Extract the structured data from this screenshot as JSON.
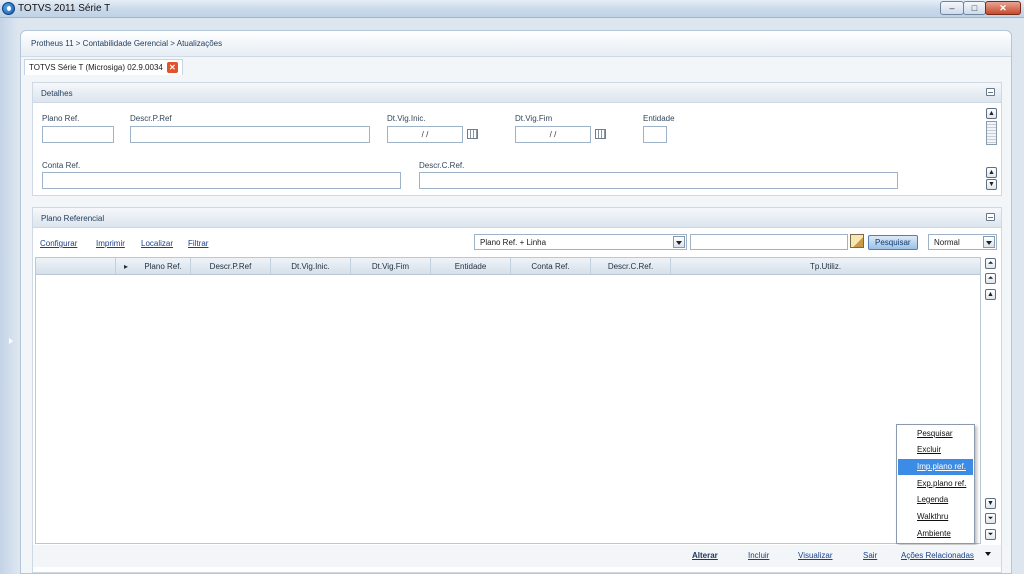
{
  "window": {
    "title": "TOTVS 2011 Série T",
    "min_glyph": "–",
    "max_glyph": "□",
    "close_glyph": "✕"
  },
  "breadcrumb": "Protheus 11 > Contabilidade Gerencial > Atualizações",
  "tab": {
    "label": "TOTVS Série T  (Microsiga) 02.9.0034",
    "close_glyph": "✕"
  },
  "detalhes": {
    "title": "Detalhes",
    "fields": {
      "plano_ref": {
        "label": "Plano Ref.",
        "value": ""
      },
      "descr_p_ref": {
        "label": "Descr.P.Ref",
        "value": ""
      },
      "dt_vig_inic": {
        "label": "Dt.Vig.Inic.",
        "value": " / / "
      },
      "dt_vig_fim": {
        "label": "Dt.Vig.Fim",
        "value": " / / "
      },
      "entidade": {
        "label": "Entidade",
        "value": ""
      },
      "conta_ref": {
        "label": "Conta Ref.",
        "value": ""
      },
      "descr_c_ref": {
        "label": "Descr.C.Ref.",
        "value": ""
      }
    }
  },
  "plano": {
    "title": "Plano Referencial",
    "links": {
      "configurar": "Configurar",
      "imprimir": "Imprimir",
      "localizar": "Localizar",
      "filtrar": "Filtrar"
    },
    "index_select": "Plano Ref. + Linha",
    "search_value": "",
    "search_button": "Pesquisar",
    "mode_select": "Normal",
    "columns": [
      "",
      "▸",
      "Plano Ref.",
      "Descr.P.Ref",
      "Dt.Vig.Inic.",
      "Dt.Vig.Fim",
      "Entidade",
      "Conta Ref.",
      "Descr.C.Ref.",
      "Tp.Utiliz."
    ]
  },
  "context_menu": {
    "items": [
      "Pesquisar",
      "Excluir",
      "Imp.plano ref.",
      "Exp.plano ref.",
      "Legenda",
      "Walkthru",
      "Ambiente"
    ],
    "selected_index": 2
  },
  "bottom_actions": {
    "alterar": "Alterar",
    "incluir": "Incluir",
    "visualizar": "Visualizar",
    "sair": "Sair",
    "acoes": "Ações Relacionadas"
  }
}
